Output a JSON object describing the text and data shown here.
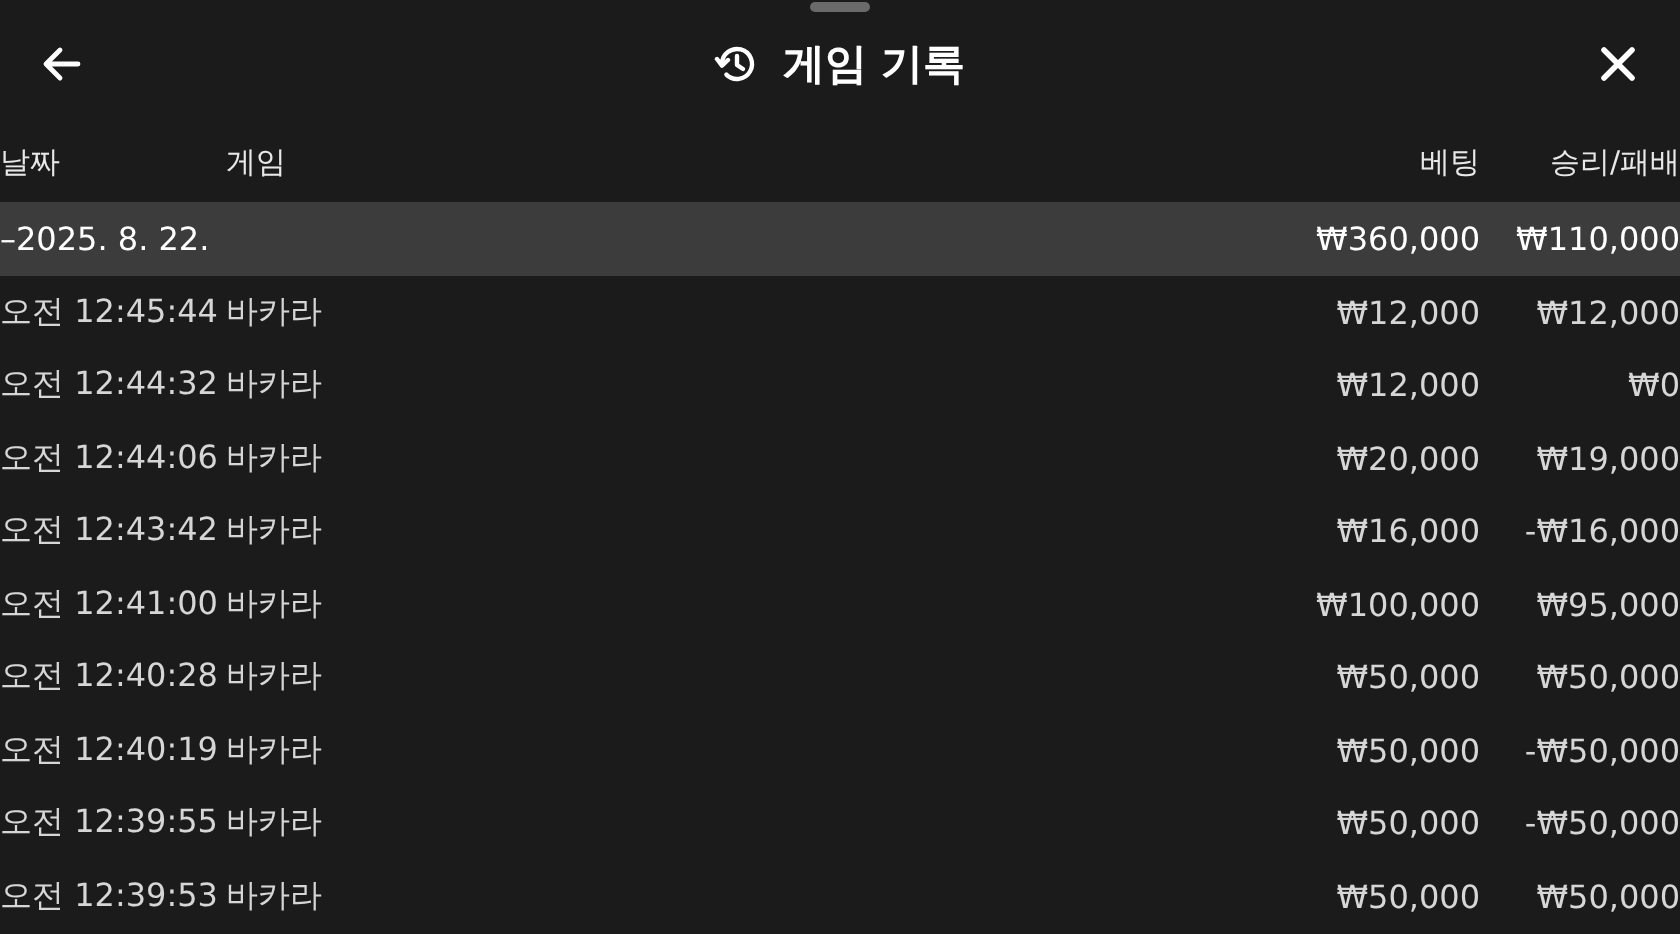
{
  "header": {
    "title": "게임 기록"
  },
  "table": {
    "columns": [
      "날짜",
      "게임",
      "베팅",
      "승리/패배"
    ],
    "group": {
      "date": "–2025. 8. 22.",
      "bet": "₩360,000",
      "result": "₩110,000"
    },
    "rows": [
      {
        "time": "오전 12:45:44",
        "game": "바카라",
        "bet": "₩12,000",
        "result": "₩12,000"
      },
      {
        "time": "오전 12:44:32",
        "game": "바카라",
        "bet": "₩12,000",
        "result": "₩0"
      },
      {
        "time": "오전 12:44:06",
        "game": "바카라",
        "bet": "₩20,000",
        "result": "₩19,000"
      },
      {
        "time": "오전 12:43:42",
        "game": "바카라",
        "bet": "₩16,000",
        "result": "-₩16,000"
      },
      {
        "time": "오전 12:41:00",
        "game": "바카라",
        "bet": "₩100,000",
        "result": "₩95,000"
      },
      {
        "time": "오전 12:40:28",
        "game": "바카라",
        "bet": "₩50,000",
        "result": "₩50,000"
      },
      {
        "time": "오전 12:40:19",
        "game": "바카라",
        "bet": "₩50,000",
        "result": "-₩50,000"
      },
      {
        "time": "오전 12:39:55",
        "game": "바카라",
        "bet": "₩50,000",
        "result": "-₩50,000"
      },
      {
        "time": "오전 12:39:53",
        "game": "바카라",
        "bet": "₩50,000",
        "result": "₩50,000"
      }
    ]
  }
}
